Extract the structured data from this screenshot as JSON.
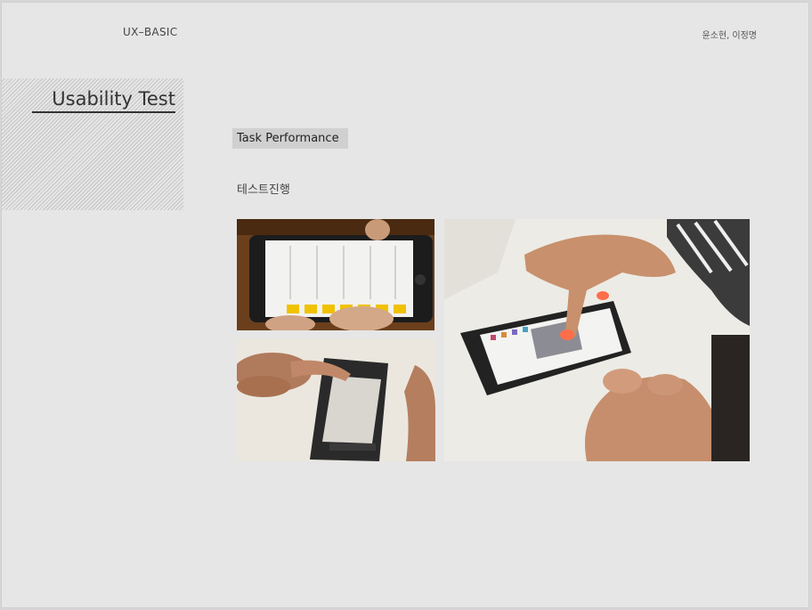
{
  "header": {
    "brand": "UX–BASIC",
    "authors": "윤소현, 이정명"
  },
  "section": {
    "title": "Usability Test"
  },
  "content": {
    "subtitle": "Task Performance",
    "label": "테스트진행"
  }
}
